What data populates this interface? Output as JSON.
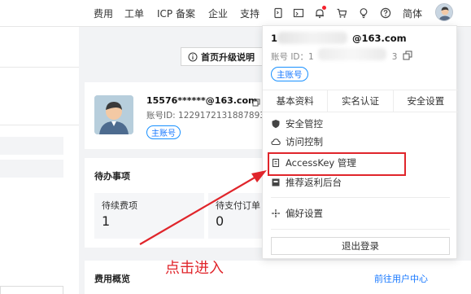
{
  "topbar": {
    "nav": [
      "费用",
      "工单",
      "ICP 备案",
      "企业",
      "支持"
    ],
    "lang": "简体",
    "icons": [
      "terminal-icon",
      "message-icon",
      "bell-icon",
      "cart-icon",
      "bulb-icon",
      "help-icon"
    ]
  },
  "upgrade_button": "首页升级说明",
  "user_card": {
    "email": "15576******@163.com",
    "account_id": "账号ID: 1229172131887893",
    "tag": "主账号"
  },
  "todo": {
    "title": "待办事项",
    "items": [
      {
        "label": "待续费项",
        "count": "1"
      },
      {
        "label": "待支付订单",
        "count": "0"
      }
    ]
  },
  "fee": {
    "title": "费用概览",
    "link": "前往用户中心"
  },
  "dropdown": {
    "name_suffix": "@163.com",
    "id_label": "账号 ID：1",
    "id_suffix": "3",
    "tag": "主账号",
    "tabs": [
      "基本资料",
      "实名认证",
      "安全设置"
    ],
    "items": [
      {
        "label": "安全管控",
        "icon": "shield-icon"
      },
      {
        "label": "访问控制",
        "icon": "cloud-icon"
      },
      {
        "label": "AccessKey 管理",
        "icon": "key-icon"
      },
      {
        "label": "推荐返利后台",
        "icon": "gift-icon"
      },
      {
        "label": "偏好设置",
        "icon": "settings-icon"
      }
    ],
    "logout": "退出登录"
  },
  "annotation": {
    "text": "点击进入",
    "color": "#e0252b"
  }
}
